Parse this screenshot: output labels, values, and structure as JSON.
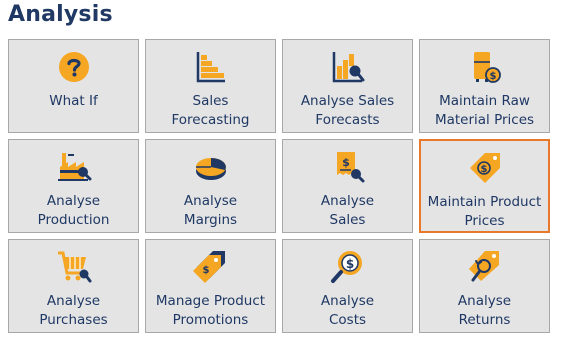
{
  "page": {
    "title": "Analysis"
  },
  "colors": {
    "icon_orange": "#f5a623",
    "icon_navy": "#1f3864",
    "selected_border": "#e8782a",
    "tile_bg": "#e4e4e4"
  },
  "tiles": [
    {
      "line1": "What If",
      "line2": "",
      "icon": "question-icon"
    },
    {
      "line1": "Sales",
      "line2": "Forecasting",
      "icon": "stepped-bar-chart-icon"
    },
    {
      "line1": "Analyse Sales",
      "line2": "Forecasts",
      "icon": "bar-chart-magnifier-icon"
    },
    {
      "line1": "Maintain Raw",
      "line2": "Material Prices",
      "icon": "container-dollar-icon"
    },
    {
      "line1": "Analyse",
      "line2": "Production",
      "icon": "factory-icon"
    },
    {
      "line1": "Analyse",
      "line2": "Margins",
      "icon": "pie-chart-icon"
    },
    {
      "line1": "Analyse",
      "line2": "Sales",
      "icon": "receipt-magnifier-icon"
    },
    {
      "line1": "Maintain Product",
      "line2": "Prices",
      "icon": "price-tag-icon"
    },
    {
      "line1": "Analyse",
      "line2": "Purchases",
      "icon": "cart-magnifier-icon"
    },
    {
      "line1": "Manage Product",
      "line2": "Promotions",
      "icon": "tags-icon"
    },
    {
      "line1": "Analyse",
      "line2": "Costs",
      "icon": "dollar-magnifier-icon"
    },
    {
      "line1": "Analyse",
      "line2": "Returns",
      "icon": "return-tag-icon"
    }
  ]
}
